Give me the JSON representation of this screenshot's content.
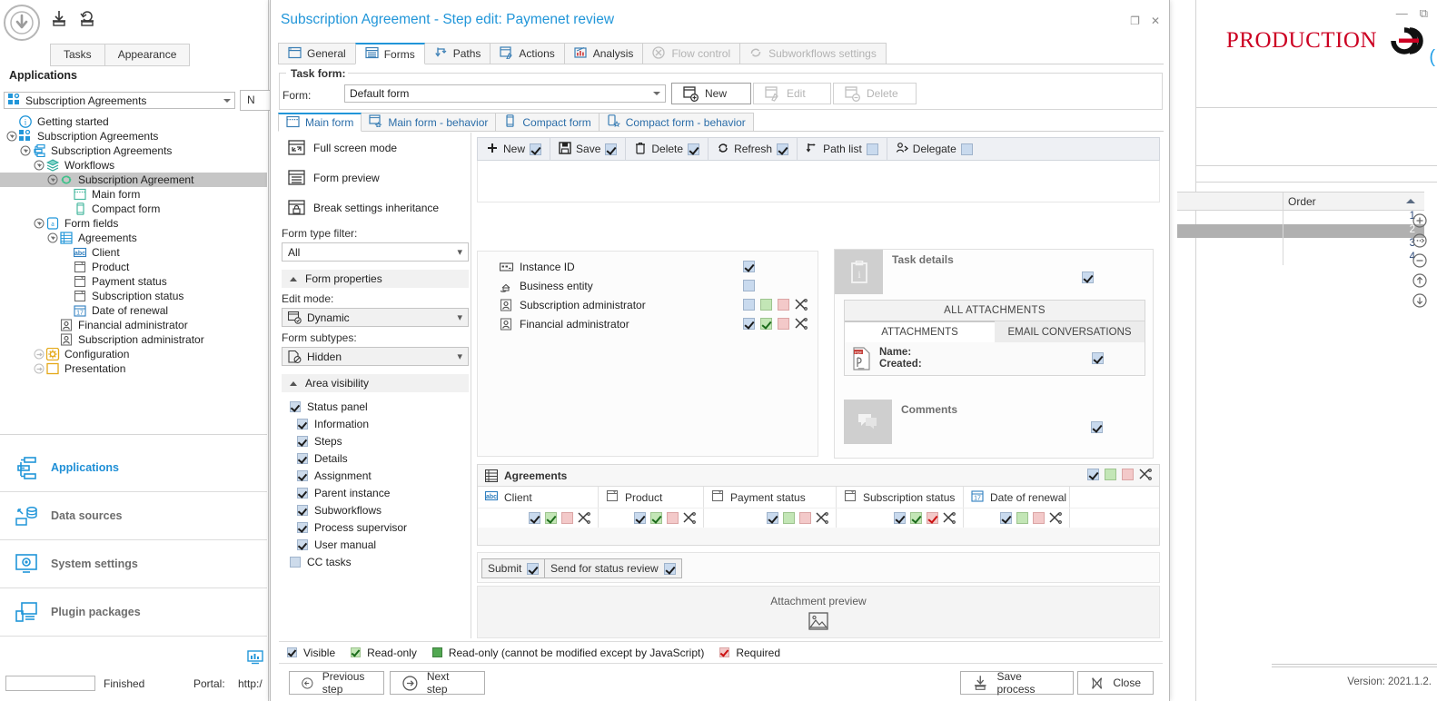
{
  "designer": {
    "top_tabs": [
      {
        "label": "Tasks",
        "active": false
      },
      {
        "label": "Appearance",
        "active": false
      }
    ],
    "applications_header": "Applications",
    "app_select_value": "Subscription Agreements",
    "cut_label": "N",
    "tree": [
      {
        "label": "Getting started",
        "depth": 0,
        "icon": "info-icon",
        "expander": "none",
        "selected": false
      },
      {
        "label": "Subscription Agreements",
        "depth": 0,
        "icon": "apps-icon",
        "expander": "collapse",
        "selected": false
      },
      {
        "label": "Subscription Agreements",
        "depth": 1,
        "icon": "process-icon",
        "expander": "collapse",
        "selected": false
      },
      {
        "label": "Workflows",
        "depth": 2,
        "icon": "layers-icon",
        "expander": "collapse",
        "selected": false
      },
      {
        "label": "Subscription Agreement",
        "depth": 3,
        "icon": "workflow-icon",
        "expander": "collapse",
        "selected": true
      },
      {
        "label": "Main form",
        "depth": 4,
        "icon": "mainform-icon",
        "expander": "none",
        "selected": false
      },
      {
        "label": "Compact form",
        "depth": 4,
        "icon": "compactform-icon",
        "expander": "none",
        "selected": false
      },
      {
        "label": "Form fields",
        "depth": 2,
        "icon": "formfields-icon",
        "expander": "collapse",
        "selected": false
      },
      {
        "label": "Agreements",
        "depth": 3,
        "icon": "table-icon",
        "expander": "collapse",
        "selected": false
      },
      {
        "label": "Client",
        "depth": 4,
        "icon": "abc-icon",
        "expander": "none",
        "selected": false
      },
      {
        "label": "Product",
        "depth": 4,
        "icon": "dropdown-icon",
        "expander": "none",
        "selected": false
      },
      {
        "label": "Payment status",
        "depth": 4,
        "icon": "dropdown-icon",
        "expander": "none",
        "selected": false
      },
      {
        "label": "Subscription status",
        "depth": 4,
        "icon": "dropdown-icon",
        "expander": "none",
        "selected": false
      },
      {
        "label": "Date of renewal",
        "depth": 4,
        "icon": "calendar-icon",
        "expander": "none",
        "selected": false
      },
      {
        "label": "Financial administrator",
        "depth": 3,
        "icon": "person-icon",
        "expander": "none",
        "selected": false
      },
      {
        "label": "Subscription administrator",
        "depth": 3,
        "icon": "person-icon",
        "expander": "none",
        "selected": false
      },
      {
        "label": "Configuration",
        "depth": 2,
        "icon": "gear-icon",
        "expander": "expand",
        "selected": false
      },
      {
        "label": "Presentation",
        "depth": 2,
        "icon": "presentation-icon",
        "expander": "expand",
        "selected": false
      }
    ],
    "nav": [
      {
        "label": "Applications",
        "icon": "applications-icon",
        "active": true
      },
      {
        "label": "Data sources",
        "icon": "data-sources-icon",
        "active": false
      },
      {
        "label": "System settings",
        "icon": "system-settings-icon",
        "active": false
      },
      {
        "label": "Plugin packages",
        "icon": "plugin-packages-icon",
        "active": false
      }
    ],
    "status": {
      "field_value": "",
      "state": "Finished",
      "portal_label": "Portal:",
      "portal_url": "http:/"
    }
  },
  "background_window": {
    "brand": "PRODUCTION",
    "version": "Version: 2021.1.2.",
    "grid": {
      "columns": [
        "",
        "Order"
      ],
      "rows": [
        {
          "order": "1",
          "selected": false
        },
        {
          "order": "2",
          "selected": true
        },
        {
          "order": "3",
          "selected": false
        },
        {
          "order": "4",
          "selected": false
        }
      ],
      "side_buttons": [
        "add-icon",
        "edit-icon",
        "remove-icon",
        "move-up-icon",
        "move-down-icon"
      ]
    }
  },
  "dialog": {
    "title": "Subscription Agreement - Step edit: Paymenet review",
    "window_controls": [
      {
        "name": "maximize",
        "glyph": "❐"
      },
      {
        "name": "close",
        "glyph": "✕"
      }
    ],
    "tabs": [
      {
        "label": "General",
        "icon": "general-icon",
        "active": false,
        "disabled": false
      },
      {
        "label": "Forms",
        "icon": "forms-icon",
        "active": true,
        "disabled": false
      },
      {
        "label": "Paths",
        "icon": "paths-icon",
        "active": false,
        "disabled": false
      },
      {
        "label": "Actions",
        "icon": "actions-icon",
        "active": false,
        "disabled": false
      },
      {
        "label": "Analysis",
        "icon": "analysis-icon",
        "active": false,
        "disabled": false
      },
      {
        "label": "Flow control",
        "icon": "flow-control-icon",
        "active": false,
        "disabled": true
      },
      {
        "label": "Subworkflows settings",
        "icon": "subworkflows-icon",
        "active": false,
        "disabled": true
      }
    ],
    "task_form": {
      "group_label": "Task form:",
      "form_label": "Form:",
      "form_value": "Default form",
      "buttons": [
        {
          "label": "New",
          "icon": "new-form-icon",
          "enabled": true
        },
        {
          "label": "Edit",
          "icon": "edit-form-icon",
          "enabled": false
        },
        {
          "label": "Delete",
          "icon": "delete-form-icon",
          "enabled": false
        }
      ]
    },
    "sub_tabs": [
      {
        "label": "Main form",
        "icon": "main-form-icon",
        "active": true
      },
      {
        "label": "Main form - behavior",
        "icon": "main-form-behavior-icon",
        "active": false
      },
      {
        "label": "Compact form",
        "icon": "compact-form-icon",
        "active": false
      },
      {
        "label": "Compact form - behavior",
        "icon": "compact-form-behavior-icon",
        "active": false
      }
    ],
    "options": {
      "actions": [
        {
          "label": "Full screen mode",
          "icon": "fullscreen-icon"
        },
        {
          "label": "Form preview",
          "icon": "form-preview-icon"
        },
        {
          "label": "Break settings inheritance",
          "icon": "lock-icon"
        }
      ],
      "form_type_filter_label": "Form type filter:",
      "form_type_filter_value": "All",
      "form_properties_label": "Form properties",
      "edit_mode_label": "Edit mode:",
      "edit_mode_value": "Dynamic",
      "form_subtypes_label": "Form subtypes:",
      "form_subtypes_value": "Hidden",
      "area_visibility_label": "Area visibility",
      "area_visibility": [
        {
          "label": "Status panel",
          "checked": true,
          "indent": 0
        },
        {
          "label": "Information",
          "checked": true,
          "indent": 1
        },
        {
          "label": "Steps",
          "checked": true,
          "indent": 1
        },
        {
          "label": "Details",
          "checked": true,
          "indent": 1
        },
        {
          "label": "Assignment",
          "checked": true,
          "indent": 1
        },
        {
          "label": "Parent instance",
          "checked": true,
          "indent": 1
        },
        {
          "label": "Subworkflows",
          "checked": true,
          "indent": 1
        },
        {
          "label": "Process supervisor",
          "checked": true,
          "indent": 1
        },
        {
          "label": "User manual",
          "checked": true,
          "indent": 1
        },
        {
          "label": "CC tasks",
          "checked": false,
          "indent": 0
        }
      ]
    },
    "preview": {
      "toolbar": [
        {
          "label": "New",
          "icon": "plus-icon",
          "checked": true
        },
        {
          "label": "Save",
          "icon": "save-icon",
          "checked": true
        },
        {
          "label": "Delete",
          "icon": "trash-icon",
          "checked": true
        },
        {
          "label": "Refresh",
          "icon": "refresh-icon",
          "checked": true
        },
        {
          "label": "Path list",
          "icon": "path-list-icon",
          "checked": false
        },
        {
          "label": "Delegate",
          "icon": "delegate-icon",
          "checked": false
        }
      ],
      "fields": [
        {
          "label": "Instance ID",
          "icon": "instance-id-icon",
          "visible": true,
          "readonly": null,
          "required": null,
          "tools": false
        },
        {
          "label": "Business entity",
          "icon": "business-entity-icon",
          "visible": false,
          "readonly": null,
          "required": null,
          "tools": false
        },
        {
          "label": "Subscription administrator",
          "icon": "person-icon",
          "visible": false,
          "readonly": false,
          "required": false,
          "tools": true
        },
        {
          "label": "Financial administrator",
          "icon": "person-icon",
          "visible": true,
          "readonly": true,
          "required": false,
          "tools": true
        }
      ],
      "task_details": {
        "title": "Task details",
        "icon": "task-details-icon",
        "checked": true,
        "all_attachments_label": "ALL ATTACHMENTS",
        "att_tabs": [
          {
            "label": "ATTACHMENTS",
            "active": true
          },
          {
            "label": "EMAIL CONVERSATIONS",
            "active": false
          }
        ],
        "attachment": {
          "icon": "pdf-icon",
          "name_label": "Name:",
          "created_label": "Created:",
          "checked": true
        },
        "comments": {
          "title": "Comments",
          "icon": "comments-icon",
          "checked": true
        }
      },
      "agreements": {
        "title": "Agreements",
        "icon": "table-icon",
        "header_states": {
          "visible": true,
          "readonly": false,
          "required": false,
          "tools": true
        },
        "columns": [
          {
            "label": "Client",
            "icon": "abc-icon",
            "visible": true,
            "readonly": true,
            "required": false,
            "tools": true
          },
          {
            "label": "Product",
            "icon": "dropdown-icon",
            "visible": true,
            "readonly": true,
            "required": false,
            "tools": true
          },
          {
            "label": "Payment status",
            "icon": "dropdown-icon",
            "visible": true,
            "readonly": false,
            "required": false,
            "tools": true
          },
          {
            "label": "Subscription status",
            "icon": "dropdown-icon",
            "visible": true,
            "readonly": true,
            "required": true,
            "tools": true
          },
          {
            "label": "Date of renewal",
            "icon": "calendar-icon",
            "visible": true,
            "readonly": false,
            "required": false,
            "tools": true
          }
        ]
      },
      "action_buttons": [
        {
          "label": "Submit",
          "checked": true
        },
        {
          "label": "Send for status review",
          "checked": true
        }
      ],
      "attachment_preview_label": "Attachment preview",
      "attachment_preview_icon": "image-icon"
    },
    "legend": [
      {
        "label": "Visible",
        "swatch": "blue",
        "checked": true
      },
      {
        "label": "Read-only",
        "swatch": "green",
        "checked": true
      },
      {
        "label": "Read-only (cannot be modified except by JavaScript)",
        "swatch": "dark-green",
        "checked": false
      },
      {
        "label": "Required",
        "swatch": "red",
        "checked": true
      }
    ],
    "footer": [
      {
        "label": "Previous step",
        "icon": "arrow-left-circle-icon",
        "align": "left"
      },
      {
        "label": "Next step",
        "icon": "arrow-right-circle-icon",
        "align": "left"
      },
      {
        "label": "Save process",
        "icon": "save-process-icon",
        "align": "right"
      },
      {
        "label": "Close",
        "icon": "close-x-icon",
        "align": "right"
      }
    ]
  }
}
